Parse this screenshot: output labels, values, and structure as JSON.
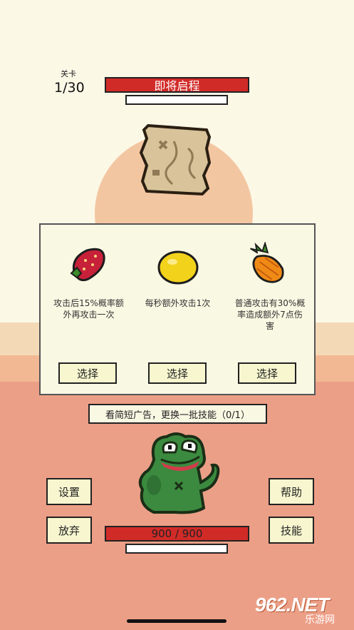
{
  "level": {
    "label": "关卡",
    "value": "1/30"
  },
  "stage": {
    "title": "即将启程"
  },
  "choices": [
    {
      "fruit": "strawberry",
      "icon": "strawberry-icon",
      "desc_line1": "攻击后15%概率额",
      "desc_line2": "外再攻击一次",
      "button": "选择"
    },
    {
      "fruit": "lemon",
      "icon": "lemon-icon",
      "desc_line1": "每秒额外攻击1次",
      "desc_line2": "",
      "button": "选择"
    },
    {
      "fruit": "pineapple",
      "icon": "pineapple-icon",
      "desc_line1": "普通攻击有30%概",
      "desc_line2": "率造成额外7点伤",
      "desc_line3": "害",
      "button": "选择"
    }
  ],
  "ad": {
    "label": "看简短广告，更换一批技能（0/1）"
  },
  "buttons": {
    "settings": "设置",
    "give_up": "放弃",
    "help": "帮助",
    "skills": "技能"
  },
  "player": {
    "hp": "900 / 900"
  },
  "watermark": {
    "brand": "962.NET",
    "sub": "乐游网"
  },
  "colors": {
    "accent_red": "#d12b28",
    "button_bg": "#f7f6cf",
    "panel_bg": "#f9f8e3",
    "ground": "#ec9f87"
  }
}
